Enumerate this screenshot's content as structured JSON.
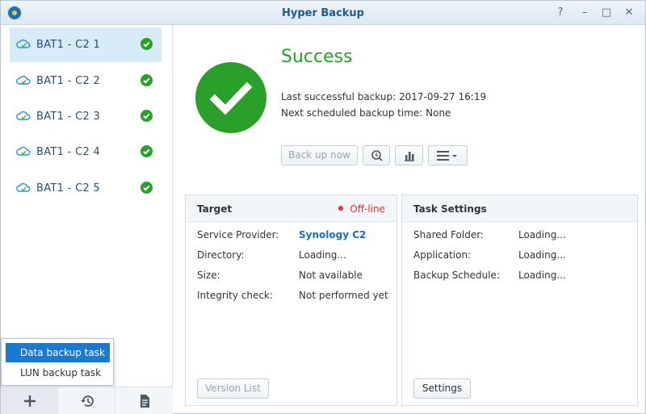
{
  "window": {
    "title": "Hyper Backup",
    "help": "?",
    "minimize": "–",
    "maximize": "□",
    "close": "✕"
  },
  "sidebar": {
    "tasks": [
      {
        "label": "BAT1 - C2 1"
      },
      {
        "label": "BAT1 - C2 2"
      },
      {
        "label": "BAT1 - C2 3"
      },
      {
        "label": "BAT1 - C2 4"
      },
      {
        "label": "BAT1 - C2 5"
      }
    ],
    "popup_menu": [
      {
        "label": "Data backup task"
      },
      {
        "label": "LUN backup task"
      }
    ]
  },
  "status": {
    "title": "Success",
    "last_backup": "Last successful backup: 2017-09-27 16:19",
    "next_backup": "Next scheduled backup time: None"
  },
  "toolbar": {
    "backup_now": "Back up now"
  },
  "target": {
    "title": "Target",
    "status": "Off-line",
    "rows": [
      {
        "label": "Service Provider:",
        "value": "Synology C2"
      },
      {
        "label": "Directory:",
        "value": "Loading..."
      },
      {
        "label": "Size:",
        "value": "Not available"
      },
      {
        "label": "Integrity check:",
        "value": "Not performed yet"
      }
    ],
    "version_list": "Version List"
  },
  "task_settings": {
    "title": "Task Settings",
    "rows": [
      {
        "label": "Shared Folder:",
        "value": "Loading..."
      },
      {
        "label": "Application:",
        "value": "Loading..."
      },
      {
        "label": "Backup Schedule:",
        "value": "Loading..."
      }
    ],
    "settings": "Settings"
  },
  "colors": {
    "success": "#2aa02a",
    "accent": "#1b7ad0",
    "offline": "#d9343a"
  }
}
